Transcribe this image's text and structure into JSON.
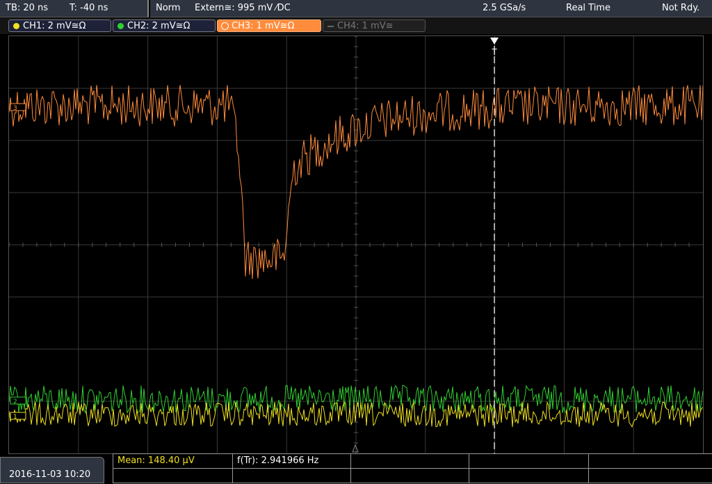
{
  "top_bar": {
    "timebase": "TB: 20 ns",
    "trigger_time": "T: -40 ns",
    "acq_mode": "Norm",
    "trigger_source": "Extern≅: 995 mV ⁄DC",
    "sample_rate": "2.5 GSa/s",
    "realtime_label": "Real Time",
    "status": "Not Rdy."
  },
  "channels": [
    {
      "label": "CH1: 2 mV≅Ω",
      "color": "#f0e020",
      "active": true
    },
    {
      "label": "CH2: 2 mV≅Ω",
      "color": "#30d030",
      "active": true
    },
    {
      "label": "CH3: 1 mV≅Ω",
      "color": "#ff8c3c",
      "active": true,
      "selected": true
    },
    {
      "label": "CH4: 1 mV≅",
      "color": "#666666",
      "active": false
    }
  ],
  "markers": {
    "ch1": "1",
    "ch2": "2",
    "ch3": "3",
    "trigger": "T"
  },
  "status_bar": {
    "datetime": "2016-11-03 10:20",
    "mean": "Mean: 148.40 µV",
    "freq": "f(Tr): 2.941966 Hz"
  },
  "colors": {
    "ch1": "#f0e020",
    "ch2": "#30d030",
    "ch3": "#ff8c3c",
    "mean_text": "#f0e020"
  }
}
